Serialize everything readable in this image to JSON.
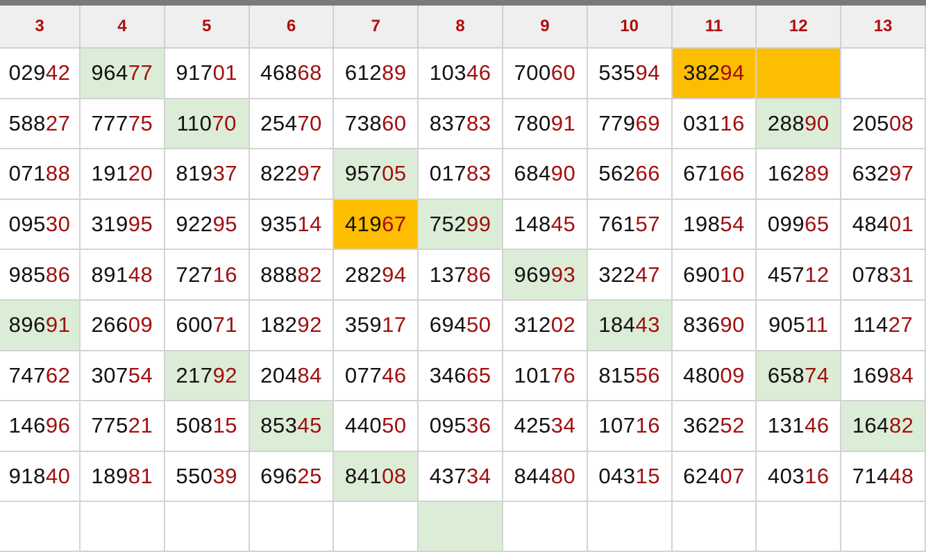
{
  "headers": [
    "3",
    "4",
    "5",
    "6",
    "7",
    "8",
    "9",
    "10",
    "11",
    "12",
    "13"
  ],
  "colors": {
    "highlight_green": "#dcedd7",
    "highlight_orange": "#fdbd00",
    "tail_red": "#a00f0f",
    "header_red": "#b00d0d"
  },
  "rows": [
    [
      {
        "a": "029",
        "b": "42"
      },
      {
        "a": "964",
        "b": "77",
        "hl": "green"
      },
      {
        "a": "917",
        "b": "01"
      },
      {
        "a": "468",
        "b": "68"
      },
      {
        "a": "612",
        "b": "89"
      },
      {
        "a": "103",
        "b": "46"
      },
      {
        "a": "700",
        "b": "60"
      },
      {
        "a": "535",
        "b": "94"
      },
      {
        "a": "382",
        "b": "94",
        "hl": "orange"
      },
      {
        "a": "",
        "b": "",
        "hl": "orange"
      },
      {
        "a": "",
        "b": "",
        "hl": "empty"
      }
    ],
    [
      {
        "a": "588",
        "b": "27"
      },
      {
        "a": "777",
        "b": "75"
      },
      {
        "a": "110",
        "b": "70",
        "hl": "green"
      },
      {
        "a": "254",
        "b": "70"
      },
      {
        "a": "738",
        "b": "60"
      },
      {
        "a": "837",
        "b": "83"
      },
      {
        "a": "780",
        "b": "91"
      },
      {
        "a": "779",
        "b": "69"
      },
      {
        "a": "031",
        "b": "16"
      },
      {
        "a": "288",
        "b": "90",
        "hl": "green"
      },
      {
        "a": "205",
        "b": "08"
      }
    ],
    [
      {
        "a": "071",
        "b": "88"
      },
      {
        "a": "191",
        "b": "20"
      },
      {
        "a": "819",
        "b": "37"
      },
      {
        "a": "822",
        "b": "97"
      },
      {
        "a": "957",
        "b": "05",
        "hl": "green"
      },
      {
        "a": "017",
        "b": "83"
      },
      {
        "a": "684",
        "b": "90"
      },
      {
        "a": "562",
        "b": "66"
      },
      {
        "a": "671",
        "b": "66"
      },
      {
        "a": "162",
        "b": "89"
      },
      {
        "a": "632",
        "b": "97"
      }
    ],
    [
      {
        "a": "095",
        "b": "30"
      },
      {
        "a": "319",
        "b": "95"
      },
      {
        "a": "922",
        "b": "95"
      },
      {
        "a": "935",
        "b": "14"
      },
      {
        "a": "419",
        "b": "67",
        "hl": "orange"
      },
      {
        "a": "752",
        "b": "99",
        "hl": "green"
      },
      {
        "a": "148",
        "b": "45"
      },
      {
        "a": "761",
        "b": "57"
      },
      {
        "a": "198",
        "b": "54"
      },
      {
        "a": "099",
        "b": "65"
      },
      {
        "a": "484",
        "b": "01"
      }
    ],
    [
      {
        "a": "985",
        "b": "86"
      },
      {
        "a": "891",
        "b": "48"
      },
      {
        "a": "727",
        "b": "16"
      },
      {
        "a": "888",
        "b": "82"
      },
      {
        "a": "282",
        "b": "94"
      },
      {
        "a": "137",
        "b": "86"
      },
      {
        "a": "969",
        "b": "93",
        "hl": "green"
      },
      {
        "a": "322",
        "b": "47"
      },
      {
        "a": "690",
        "b": "10"
      },
      {
        "a": "457",
        "b": "12"
      },
      {
        "a": "078",
        "b": "31"
      }
    ],
    [
      {
        "a": "896",
        "b": "91",
        "hl": "green"
      },
      {
        "a": "266",
        "b": "09"
      },
      {
        "a": "600",
        "b": "71"
      },
      {
        "a": "182",
        "b": "92"
      },
      {
        "a": "359",
        "b": "17"
      },
      {
        "a": "694",
        "b": "50"
      },
      {
        "a": "312",
        "b": "02"
      },
      {
        "a": "184",
        "b": "43",
        "hl": "green"
      },
      {
        "a": "836",
        "b": "90"
      },
      {
        "a": "905",
        "b": "11"
      },
      {
        "a": "114",
        "b": "27"
      }
    ],
    [
      {
        "a": "747",
        "b": "62"
      },
      {
        "a": "307",
        "b": "54"
      },
      {
        "a": "217",
        "b": "92",
        "hl": "green"
      },
      {
        "a": "204",
        "b": "84"
      },
      {
        "a": "077",
        "b": "46"
      },
      {
        "a": "346",
        "b": "65"
      },
      {
        "a": "101",
        "b": "76"
      },
      {
        "a": "815",
        "b": "56"
      },
      {
        "a": "480",
        "b": "09"
      },
      {
        "a": "658",
        "b": "74",
        "hl": "green"
      },
      {
        "a": "169",
        "b": "84"
      }
    ],
    [
      {
        "a": "146",
        "b": "96"
      },
      {
        "a": "775",
        "b": "21"
      },
      {
        "a": "508",
        "b": "15"
      },
      {
        "a": "853",
        "b": "45",
        "hl": "green"
      },
      {
        "a": "440",
        "b": "50"
      },
      {
        "a": "095",
        "b": "36"
      },
      {
        "a": "425",
        "b": "34"
      },
      {
        "a": "107",
        "b": "16"
      },
      {
        "a": "362",
        "b": "52"
      },
      {
        "a": "131",
        "b": "46"
      },
      {
        "a": "164",
        "b": "82",
        "hl": "green"
      }
    ],
    [
      {
        "a": "918",
        "b": "40"
      },
      {
        "a": "189",
        "b": "81"
      },
      {
        "a": "550",
        "b": "39"
      },
      {
        "a": "696",
        "b": "25"
      },
      {
        "a": "841",
        "b": "08",
        "hl": "green"
      },
      {
        "a": "437",
        "b": "34"
      },
      {
        "a": "844",
        "b": "80"
      },
      {
        "a": "043",
        "b": "15"
      },
      {
        "a": "624",
        "b": "07"
      },
      {
        "a": "403",
        "b": "16"
      },
      {
        "a": "714",
        "b": "48"
      }
    ]
  ],
  "partial_row_highlights": [
    false,
    false,
    false,
    false,
    false,
    true,
    false,
    false,
    false,
    false,
    false
  ]
}
